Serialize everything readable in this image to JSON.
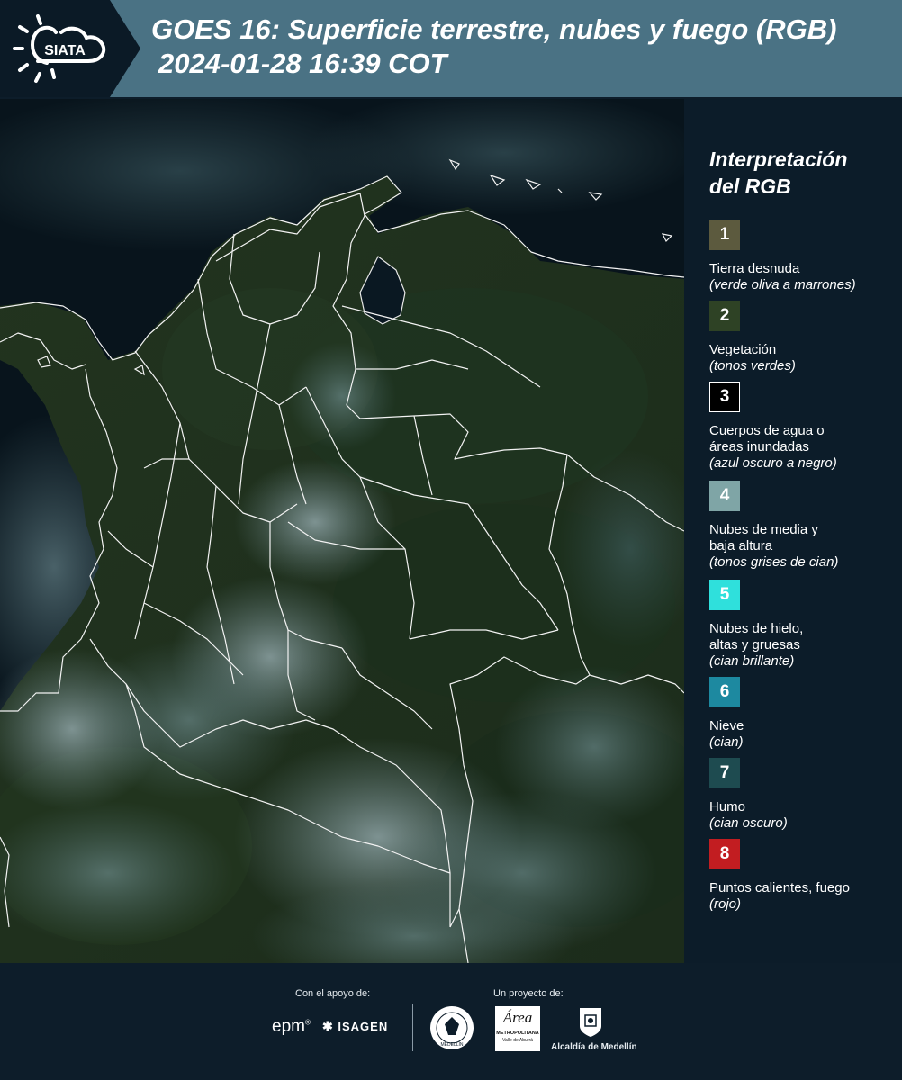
{
  "header": {
    "title_line1": "GOES 16: Superficie terrestre, nubes y fuego (RGB)",
    "title_line2": "2024-01-28 16:39 COT",
    "logo_text": "SIATA"
  },
  "legend": {
    "title_line1": "Interpretación",
    "title_line2": "del RGB",
    "items": [
      {
        "num": "1",
        "color": "#5c5a3e",
        "label1": "Tierra desnuda",
        "label2": "",
        "sub": "(verde oliva a marrones)"
      },
      {
        "num": "2",
        "color": "#2e4225",
        "label1": "Vegetación",
        "label2": "",
        "sub": "(tonos verdes)"
      },
      {
        "num": "3",
        "color": "#000000",
        "label1": "Cuerpos de agua o",
        "label2": "áreas inundadas",
        "sub": "(azul oscuro a negro)"
      },
      {
        "num": "4",
        "color": "#7fa5a6",
        "label1": "Nubes de media y",
        "label2": "baja altura",
        "sub": "(tonos grises de cian)"
      },
      {
        "num": "5",
        "color": "#2fe0dc",
        "label1": "Nubes de hielo,",
        "label2": "altas y gruesas",
        "sub": "(cian brillante)"
      },
      {
        "num": "6",
        "color": "#1d89a0",
        "label1": "Nieve",
        "label2": "",
        "sub": "(cian)"
      },
      {
        "num": "7",
        "color": "#1e4b50",
        "label1": "Humo",
        "label2": "",
        "sub": "(cian oscuro)"
      },
      {
        "num": "8",
        "color": "#c21d21",
        "label1": "Puntos calientes, fuego",
        "label2": "",
        "sub": "(rojo)"
      }
    ]
  },
  "footer": {
    "support_label": "Con el apoyo de:",
    "project_label": "Un proyecto de:",
    "epm": "epm",
    "isagen": "ISAGEN",
    "area_script": "Área",
    "area_line1": "METROPOLITANA",
    "area_line2": "Valle de Aburrá",
    "alcaldia": "Alcaldía de Medellín",
    "seal_text": "MEDELLÍN"
  },
  "colors": {
    "header_band": "#4a7284",
    "header_dark": "#0b1a26",
    "page_bg": "#0d1d2a"
  }
}
